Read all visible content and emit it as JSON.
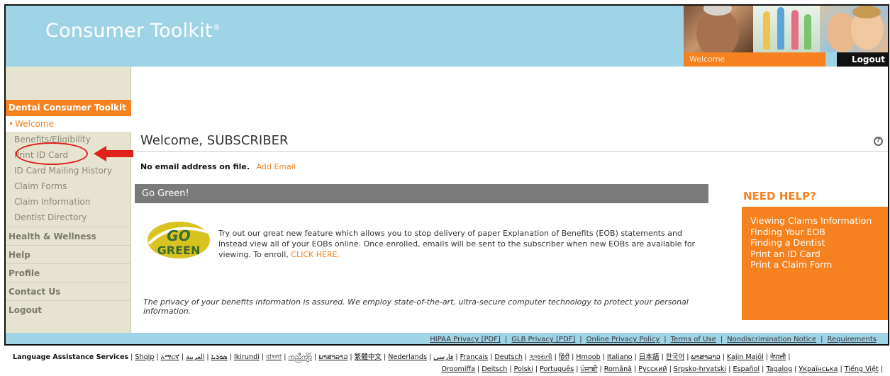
{
  "header": {
    "logo": "Consumer Toolkit",
    "logo_mark": "®",
    "welcome": "Welcome",
    "logout": "Logout"
  },
  "sidebar": {
    "section_title": "Dental Consumer Toolkit",
    "sub_items": [
      {
        "label": "Welcome"
      },
      {
        "label": "Benefits/Eligibility"
      },
      {
        "label": "Print ID Card"
      },
      {
        "label": "ID Card Mailing History"
      },
      {
        "label": "Claim Forms"
      },
      {
        "label": "Claim Information"
      },
      {
        "label": "Dentist Directory"
      }
    ],
    "main_items": [
      {
        "label": "Health & Wellness"
      },
      {
        "label": "Help"
      },
      {
        "label": "Profile"
      },
      {
        "label": "Contact Us"
      },
      {
        "label": "Logout"
      }
    ]
  },
  "main": {
    "title": "Welcome, SUBSCRIBER",
    "email_notice": "No email address on file.",
    "add_email": "Add Email",
    "go_green_title": "Go Green!",
    "go_green_logo_top": "GO",
    "go_green_logo_bottom": "GREEN",
    "go_green_text": "Try out our great new feature which allows you to stop delivery of paper Explanation of Benefits (EOB) statements and instead view all of your EOBs online. Once enrolled, emails will be sent to the subscriber when new EOBs are available for viewing. To enroll,",
    "click_here": "CLICK HERE.",
    "privacy": "The privacy of your benefits information is assured. We employ state-of-the-art, ultra-secure computer technology to protect your personal information."
  },
  "need_help": {
    "title": "NEED HELP?",
    "links": [
      {
        "label": "Viewing Claims Information"
      },
      {
        "label": "Finding Your EOB"
      },
      {
        "label": "Finding a Dentist"
      },
      {
        "label": "Print an ID Card"
      },
      {
        "label": "Print a Claim Form"
      }
    ]
  },
  "footer": {
    "links": [
      {
        "label": "HIPAA Privacy [PDF]"
      },
      {
        "label": "GLB Privacy [PDF]"
      },
      {
        "label": "Online Privacy Policy"
      },
      {
        "label": "Terms of Use"
      },
      {
        "label": "Nondiscrimination Notice"
      },
      {
        "label": "Requirements"
      }
    ]
  },
  "language": {
    "label": "Language Assistance Services",
    "row1": [
      "Shqip",
      "አማርኛ",
      "ܣܘܪܝܐ",
      "العربية",
      "Ikirundi",
      "বাংলা",
      "ကညီကျိာ်",
      "ພາສາລາວ",
      "繁體中文",
      "Nederlands",
      "فارسی",
      "Français",
      "Deutsch",
      "ગુજરાતી",
      "हिंदी",
      "Hmoob",
      "Italiano",
      "日本語",
      "한국어",
      "ພາສາລາວ",
      "Kajin Majōl",
      "नेपाली"
    ],
    "row2": [
      "Oroomiffa",
      "Deitsch",
      "Polski",
      "Português",
      "ਪੰਜਾਬੀ",
      "Română",
      "Русский",
      "Srpsko-hrvatski",
      "Español",
      "Tagalog",
      "Українська",
      "Tiếng Việt"
    ]
  },
  "colors": {
    "header_blue": "#9fd3e6",
    "accent_orange": "#f5821f",
    "sidebar_bg": "#e6e3cf",
    "bar_gray": "#7a7a7a"
  }
}
